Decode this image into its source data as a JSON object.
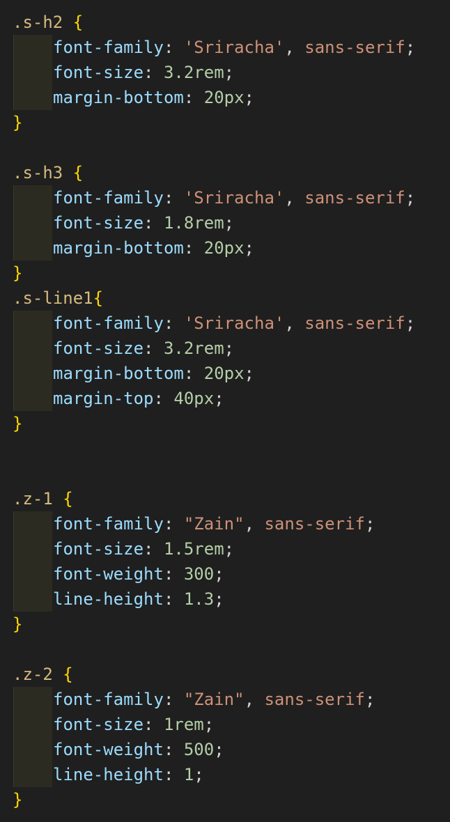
{
  "editor": {
    "colors": {
      "background": "#1f1f1f",
      "selector": "#d7ba7d",
      "brace": "#ffd700",
      "property": "#9cdcfe",
      "string": "#ce9178",
      "number": "#b5cea8",
      "punctuation": "#d4d4d4",
      "indent_guide": "#2c2b21"
    },
    "rules": [
      {
        "selector": ".s-h2",
        "open": " {",
        "declarations": [
          {
            "property": "font-family",
            "value_parts": [
              {
                "t": "str",
                "v": "'Sriracha'"
              },
              {
                "t": "punc",
                "v": ", "
              },
              {
                "t": "kw",
                "v": "sans-serif"
              }
            ]
          },
          {
            "property": "font-size",
            "value_parts": [
              {
                "t": "num",
                "v": "3.2rem"
              }
            ]
          },
          {
            "property": "margin-bottom",
            "value_parts": [
              {
                "t": "num",
                "v": "20px"
              }
            ]
          }
        ],
        "close": "}"
      },
      {
        "selector": ".s-h3",
        "open": " {",
        "declarations": [
          {
            "property": "font-family",
            "value_parts": [
              {
                "t": "str",
                "v": "'Sriracha'"
              },
              {
                "t": "punc",
                "v": ", "
              },
              {
                "t": "kw",
                "v": "sans-serif"
              }
            ]
          },
          {
            "property": "font-size",
            "value_parts": [
              {
                "t": "num",
                "v": "1.8rem"
              }
            ]
          },
          {
            "property": "margin-bottom",
            "value_parts": [
              {
                "t": "num",
                "v": "20px"
              }
            ]
          }
        ],
        "close": "}"
      },
      {
        "selector": ".s-line1",
        "open": "{",
        "declarations": [
          {
            "property": "font-family",
            "value_parts": [
              {
                "t": "str",
                "v": "'Sriracha'"
              },
              {
                "t": "punc",
                "v": ", "
              },
              {
                "t": "kw",
                "v": "sans-serif"
              }
            ]
          },
          {
            "property": "font-size",
            "value_parts": [
              {
                "t": "num",
                "v": "3.2rem"
              }
            ]
          },
          {
            "property": "margin-bottom",
            "value_parts": [
              {
                "t": "num",
                "v": "20px"
              }
            ]
          },
          {
            "property": "margin-top",
            "value_parts": [
              {
                "t": "num",
                "v": "40px"
              }
            ]
          }
        ],
        "close": "}"
      },
      {
        "selector": ".z-1",
        "open": " {",
        "declarations": [
          {
            "property": "font-family",
            "value_parts": [
              {
                "t": "str",
                "v": "\"Zain\""
              },
              {
                "t": "punc",
                "v": ", "
              },
              {
                "t": "kw",
                "v": "sans-serif"
              }
            ]
          },
          {
            "property": "font-size",
            "value_parts": [
              {
                "t": "num",
                "v": "1.5rem"
              }
            ]
          },
          {
            "property": "font-weight",
            "value_parts": [
              {
                "t": "num",
                "v": "300"
              }
            ]
          },
          {
            "property": "line-height",
            "value_parts": [
              {
                "t": "num",
                "v": "1.3"
              }
            ]
          }
        ],
        "close": "}"
      },
      {
        "selector": ".z-2",
        "open": " {",
        "declarations": [
          {
            "property": "font-family",
            "value_parts": [
              {
                "t": "str",
                "v": "\"Zain\""
              },
              {
                "t": "punc",
                "v": ", "
              },
              {
                "t": "kw",
                "v": "sans-serif"
              }
            ]
          },
          {
            "property": "font-size",
            "value_parts": [
              {
                "t": "num",
                "v": "1rem"
              }
            ]
          },
          {
            "property": "font-weight",
            "value_parts": [
              {
                "t": "num",
                "v": "500"
              }
            ]
          },
          {
            "property": "line-height",
            "value_parts": [
              {
                "t": "num",
                "v": "1"
              }
            ]
          }
        ],
        "close": "}"
      }
    ]
  }
}
